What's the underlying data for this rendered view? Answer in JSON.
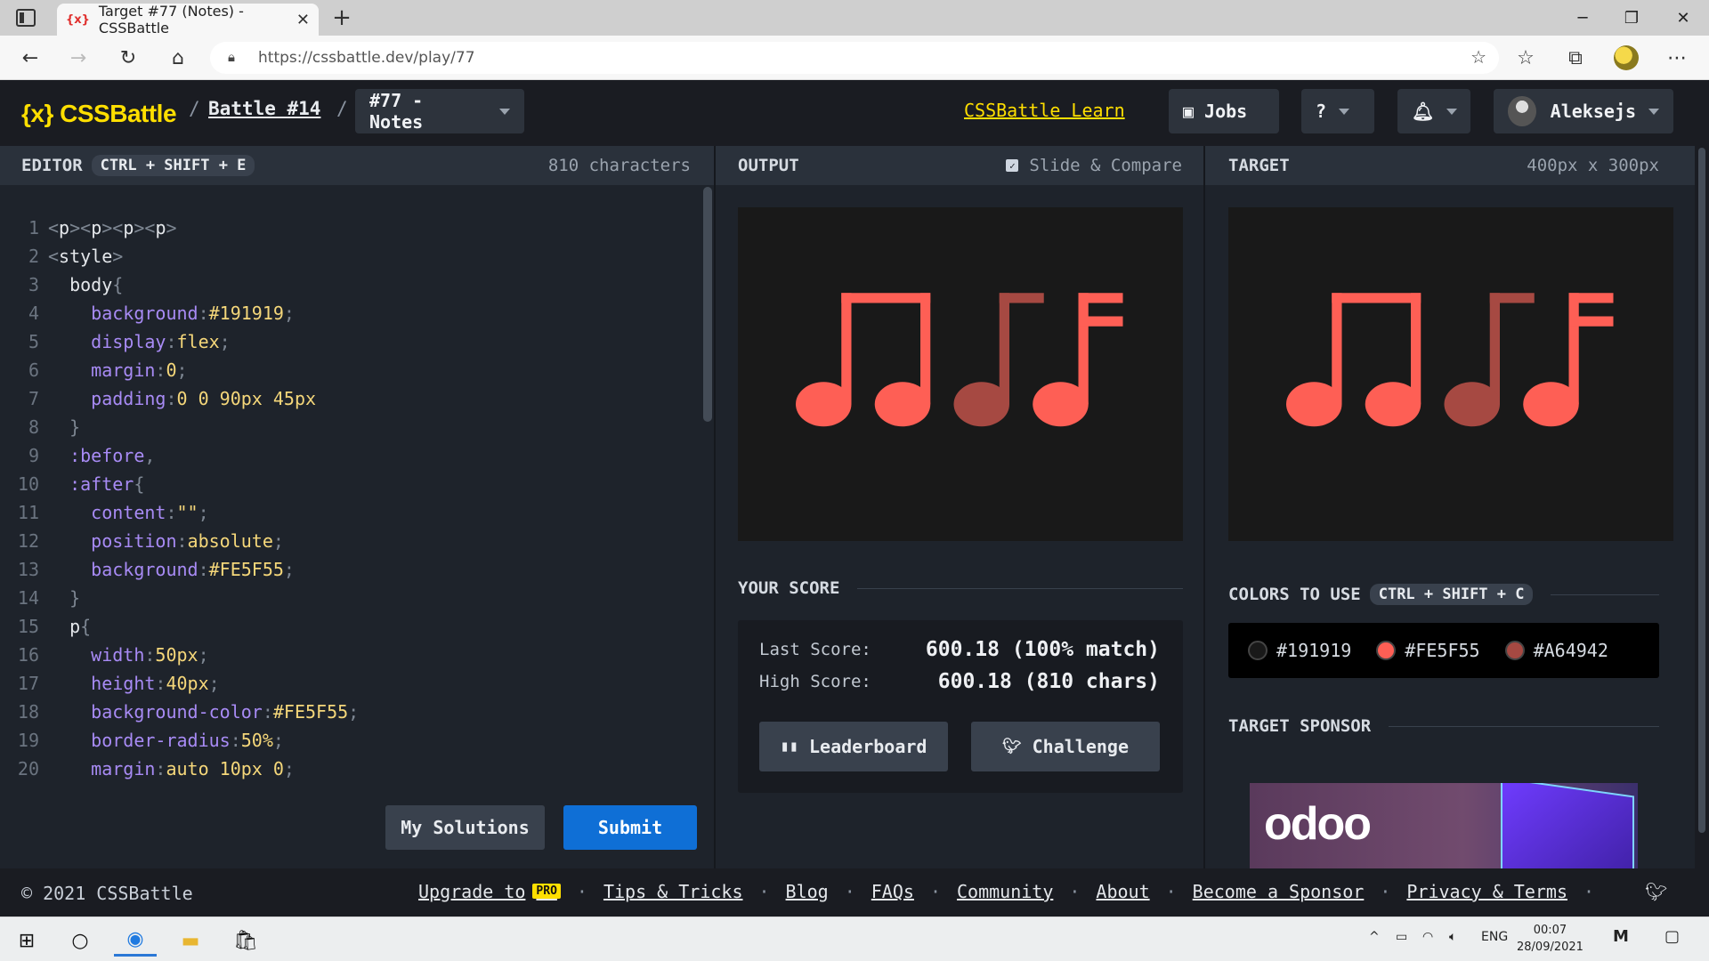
{
  "browser": {
    "tab_title": "Target #77 (Notes) - CSSBattle",
    "tab_favicon": "{x}",
    "url": "https://cssbattle.dev/play/77"
  },
  "header": {
    "logo": "{x} CSSBattle",
    "crumb_sep": "/",
    "battle": "Battle #14",
    "target": "#77 - Notes",
    "learn": "CSSBattle Learn",
    "jobs": "Jobs",
    "user": "Aleksejs"
  },
  "editor": {
    "title": "EDITOR",
    "shortcut": "CTRL + SHIFT + E",
    "chars": "810 characters",
    "my_solutions": "My Solutions",
    "submit": "Submit"
  },
  "code_lines": [
    [
      [
        "c-punc",
        "<"
      ],
      [
        "c-tag",
        "p"
      ],
      [
        "c-punc",
        ">"
      ],
      [
        "c-punc",
        "<"
      ],
      [
        "c-tag",
        "p"
      ],
      [
        "c-punc",
        ">"
      ],
      [
        "c-punc",
        "<"
      ],
      [
        "c-tag",
        "p"
      ],
      [
        "c-punc",
        ">"
      ],
      [
        "c-punc",
        "<"
      ],
      [
        "c-tag",
        "p"
      ],
      [
        "c-punc",
        ">"
      ]
    ],
    [
      [
        "c-punc",
        "<"
      ],
      [
        "c-tag",
        "style"
      ],
      [
        "c-punc",
        ">"
      ]
    ],
    [
      [
        "c-sel",
        "  body"
      ],
      [
        "c-punc",
        "{"
      ]
    ],
    [
      [
        "c-prop",
        "    background"
      ],
      [
        "c-punc",
        ":"
      ],
      [
        "c-val",
        "#191919"
      ],
      [
        "c-punc",
        ";"
      ]
    ],
    [
      [
        "c-prop",
        "    display"
      ],
      [
        "c-punc",
        ":"
      ],
      [
        "c-val",
        "flex"
      ],
      [
        "c-punc",
        ";"
      ]
    ],
    [
      [
        "c-prop",
        "    margin"
      ],
      [
        "c-punc",
        ":"
      ],
      [
        "c-val",
        "0"
      ],
      [
        "c-punc",
        ";"
      ]
    ],
    [
      [
        "c-prop",
        "    padding"
      ],
      [
        "c-punc",
        ":"
      ],
      [
        "c-val",
        "0 0 90px 45px"
      ]
    ],
    [
      [
        "c-punc",
        "  }"
      ]
    ],
    [
      [
        "c-prop",
        "  :before"
      ],
      [
        "c-punc",
        ","
      ]
    ],
    [
      [
        "c-prop",
        "  :after"
      ],
      [
        "c-punc",
        "{"
      ]
    ],
    [
      [
        "c-prop",
        "    content"
      ],
      [
        "c-punc",
        ":"
      ],
      [
        "c-val",
        "\"\""
      ],
      [
        "c-punc",
        ";"
      ]
    ],
    [
      [
        "c-prop",
        "    position"
      ],
      [
        "c-punc",
        ":"
      ],
      [
        "c-val",
        "absolute"
      ],
      [
        "c-punc",
        ";"
      ]
    ],
    [
      [
        "c-prop",
        "    background"
      ],
      [
        "c-punc",
        ":"
      ],
      [
        "c-val",
        "#FE5F55"
      ],
      [
        "c-punc",
        ";"
      ]
    ],
    [
      [
        "c-punc",
        "  }"
      ]
    ],
    [
      [
        "c-sel",
        "  p"
      ],
      [
        "c-punc",
        "{"
      ]
    ],
    [
      [
        "c-prop",
        "    width"
      ],
      [
        "c-punc",
        ":"
      ],
      [
        "c-val",
        "50px"
      ],
      [
        "c-punc",
        ";"
      ]
    ],
    [
      [
        "c-prop",
        "    height"
      ],
      [
        "c-punc",
        ":"
      ],
      [
        "c-val",
        "40px"
      ],
      [
        "c-punc",
        ";"
      ]
    ],
    [
      [
        "c-prop",
        "    background-color"
      ],
      [
        "c-punc",
        ":"
      ],
      [
        "c-val",
        "#FE5F55"
      ],
      [
        "c-punc",
        ";"
      ]
    ],
    [
      [
        "c-prop",
        "    border-radius"
      ],
      [
        "c-punc",
        ":"
      ],
      [
        "c-val",
        "50%"
      ],
      [
        "c-punc",
        ";"
      ]
    ],
    [
      [
        "c-prop",
        "    margin"
      ],
      [
        "c-punc",
        ":"
      ],
      [
        "c-val",
        "auto 10px 0"
      ],
      [
        "c-punc",
        ";"
      ]
    ]
  ],
  "output": {
    "title": "OUTPUT",
    "slide_compare": "Slide & Compare"
  },
  "target": {
    "title": "TARGET",
    "size": "400px x 300px"
  },
  "score": {
    "title": "YOUR SCORE",
    "last_label": "Last Score:",
    "last_value": "600.18 (100% match)",
    "high_label": "High Score:",
    "high_value": "600.18 (810 chars)",
    "leaderboard": "Leaderboard",
    "challenge": "Challenge"
  },
  "colors": {
    "title": "COLORS TO USE",
    "shortcut": "CTRL + SHIFT + C",
    "items": [
      {
        "hex": "#191919",
        "label": "#191919"
      },
      {
        "hex": "#FE5F55",
        "label": "#FE5F55"
      },
      {
        "hex": "#A64942",
        "label": "#A64942"
      }
    ]
  },
  "sponsor": {
    "title": "TARGET SPONSOR",
    "brand": "odoo"
  },
  "footer": {
    "copy": "© 2021 CSSBattle",
    "upgrade": "Upgrade to",
    "pro": "PRO",
    "links": [
      "Tips & Tricks",
      "Blog",
      "FAQs",
      "Community",
      "About",
      "Become a Sponsor",
      "Privacy & Terms"
    ]
  },
  "taskbar": {
    "lang": "ENG",
    "time": "00:07",
    "date": "28/09/2021"
  },
  "palette": {
    "accent": "#FE5F55",
    "accent_dark": "#A64942",
    "bg": "#191919",
    "brand_yellow": "#ffdf00",
    "submit_blue": "#0f6fd6"
  }
}
